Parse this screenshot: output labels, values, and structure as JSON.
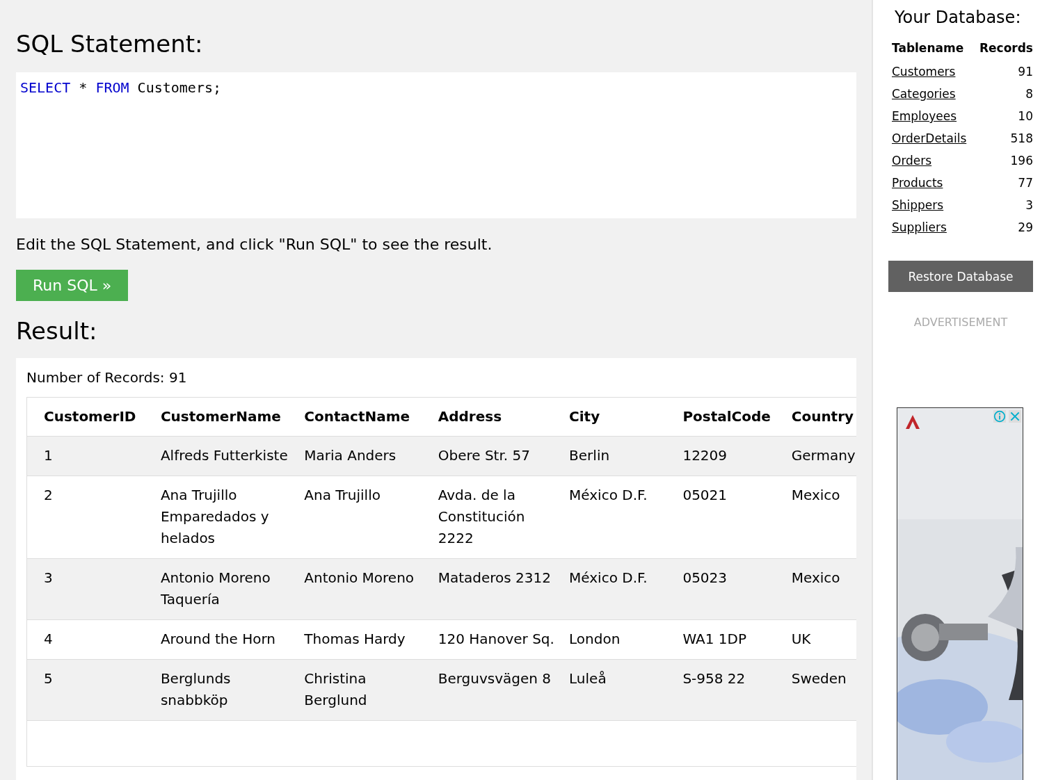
{
  "editor": {
    "heading": "SQL Statement:",
    "code": [
      {
        "kind": "keyword",
        "text": "SELECT"
      },
      {
        "kind": "plain",
        "text": " * "
      },
      {
        "kind": "keyword",
        "text": "FROM"
      },
      {
        "kind": "plain",
        "text": " Customers;"
      }
    ]
  },
  "instructions": "Edit the SQL Statement, and click \"Run SQL\" to see the result.",
  "run_button": "Run SQL »",
  "result": {
    "heading": "Result:",
    "count": "Number of Records: 91",
    "columns": [
      "CustomerID",
      "CustomerName",
      "ContactName",
      "Address",
      "City",
      "PostalCode",
      "Country"
    ],
    "rows": [
      [
        "1",
        "Alfreds Futterkiste",
        "Maria Anders",
        "Obere Str. 57",
        "Berlin",
        "12209",
        "Germany"
      ],
      [
        "2",
        "Ana Trujillo Emparedados y helados",
        "Ana Trujillo",
        "Avda. de la Constitución 2222",
        "México D.F.",
        "05021",
        "Mexico"
      ],
      [
        "3",
        "Antonio Moreno Taquería",
        "Antonio Moreno",
        "Mataderos 2312",
        "México D.F.",
        "05023",
        "Mexico"
      ],
      [
        "4",
        "Around the Horn",
        "Thomas Hardy",
        "120 Hanover Sq.",
        "London",
        "WA1 1DP",
        "UK"
      ],
      [
        "5",
        "Berglunds snabbköp",
        "Christina Berglund",
        "Berguvsvägen 8",
        "Luleå",
        "S-958 22",
        "Sweden"
      ]
    ]
  },
  "sidebar": {
    "title": "Your Database:",
    "columns": [
      "Tablename",
      "Records"
    ],
    "tables": [
      {
        "name": "Customers",
        "records": "91"
      },
      {
        "name": "Categories",
        "records": "8"
      },
      {
        "name": "Employees",
        "records": "10"
      },
      {
        "name": "OrderDetails",
        "records": "518"
      },
      {
        "name": "Orders",
        "records": "196"
      },
      {
        "name": "Products",
        "records": "77"
      },
      {
        "name": "Shippers",
        "records": "3"
      },
      {
        "name": "Suppliers",
        "records": "29"
      }
    ],
    "restore_button": "Restore Database",
    "ad_label": "ADVERTISEMENT"
  }
}
